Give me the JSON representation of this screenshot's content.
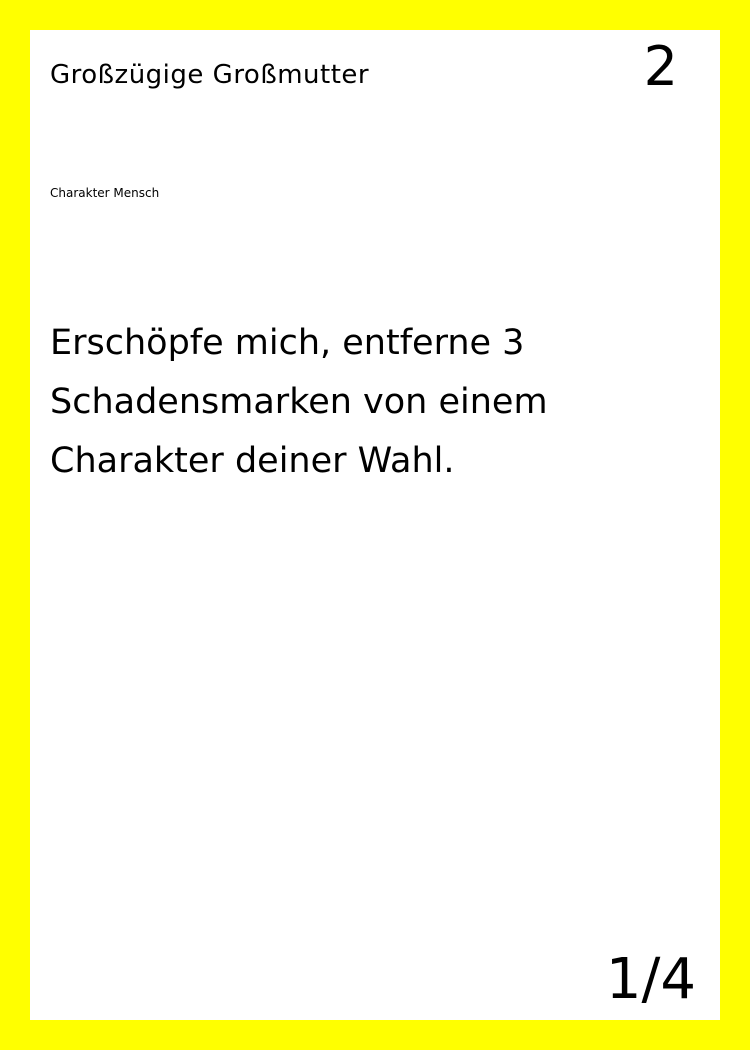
{
  "card": {
    "name": "Großzügige Großmutter",
    "cost": "2",
    "type": "Charakter Mensch",
    "text": "Erschöpfe mich, entferne 3 Schadensmarken von einem Charakter deiner Wahl.",
    "set_number": "1/4"
  },
  "colors": {
    "border": "#ffff00",
    "card_background": "#ffffff",
    "text": "#000000"
  }
}
